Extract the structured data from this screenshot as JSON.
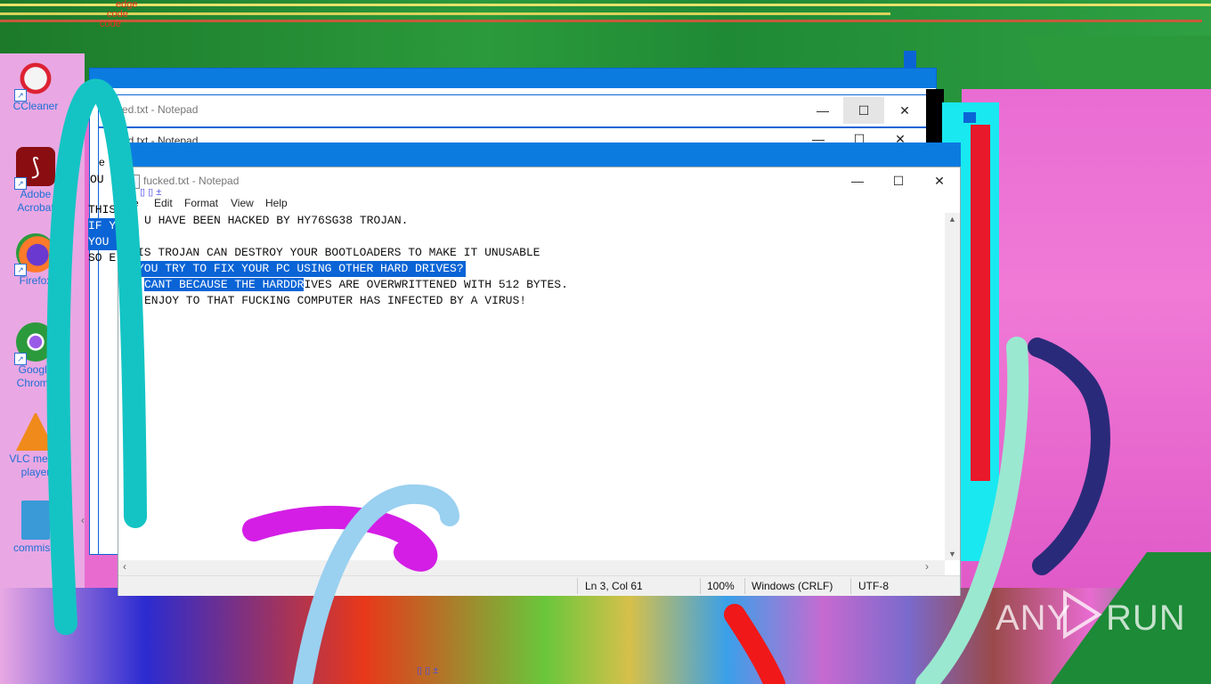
{
  "desktop": {
    "icons": [
      {
        "label": "CCleaner",
        "icon": "ccleaner-icon"
      },
      {
        "label": "Adobe Acrobat",
        "icon": "acrobat-icon"
      },
      {
        "label": "Firefox",
        "icon": "firefox-icon"
      },
      {
        "label": "Google Chrome",
        "icon": "chrome-icon"
      },
      {
        "label": "VLC media player",
        "icon": "vlc-icon"
      },
      {
        "label": "commissi",
        "icon": "image-file-icon"
      }
    ],
    "edge_text": [
      "edge",
      "code",
      "code"
    ]
  },
  "back_windows": [
    {
      "title": "ked.txt - Notepad"
    },
    {
      "title": "ked.txt - Notepad"
    }
  ],
  "back_text": {
    "line1": "THIS",
    "line2": "IF Y",
    "line3": "YOU ",
    "line4": "SO E",
    "fragment": "OU",
    "fragment2": "e"
  },
  "notepad": {
    "title": "fucked.txt - Notepad",
    "menu": {
      "file": "e",
      "edit": "Edit",
      "format": "Format",
      "view": "View",
      "help": "Help"
    },
    "lines": [
      {
        "text": "U HAVE BEEN HACKED BY HY76SG38 TROJAN."
      },
      {
        "text": "IS TROJAN CAN DESTROY YOUR BOOTLOADERS TO MAKE IT UNUSABLE"
      },
      {
        "text": "YOU TRY TO FIX YOUR PC USING OTHER HARD DRIVES?"
      },
      {
        "sel": "CANT BECAUSE THE HARDDR",
        "rest": "IVES ARE OVERWRITTENED WITH 512 BYTES."
      },
      {
        "text": "ENJOY TO THAT FUCKING COMPUTER HAS INFECTED BY A VIRUS!"
      }
    ],
    "status": {
      "position": "Ln 3, Col 61",
      "zoom": "100%",
      "line_ending": "Windows (CRLF)",
      "encoding": "UTF-8"
    },
    "glitch_glyphs": "▯ ▯ ±"
  },
  "bottom_glitch": "▯ ▯ ±",
  "watermark": {
    "text_left": "ANY",
    "text_right": "RUN"
  },
  "colors": {
    "accent": "#0a64d6",
    "titlebar": "#0c7be0"
  }
}
